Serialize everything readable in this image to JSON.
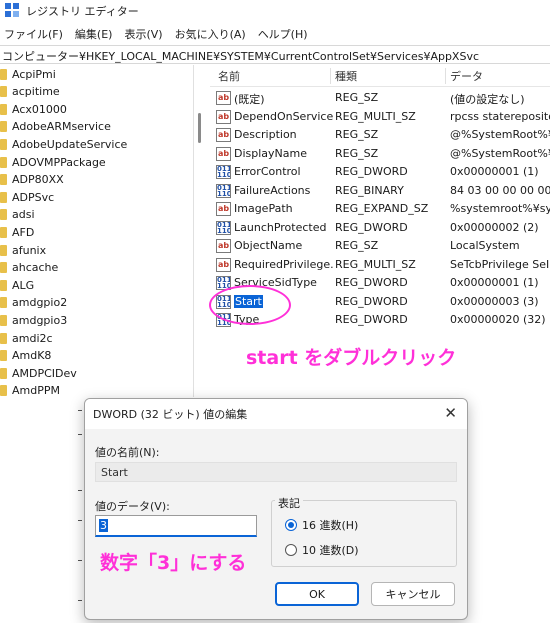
{
  "window": {
    "title": "レジストリ エディター"
  },
  "menu": [
    "ファイル(F)",
    "編集(E)",
    "表示(V)",
    "お気に入り(A)",
    "ヘルプ(H)"
  ],
  "address_path": "コンピューター¥HKEY_LOCAL_MACHINE¥SYSTEM¥CurrentControlSet¥Services¥AppXSvc",
  "tree": [
    "AcpiPmi",
    "acpitime",
    "Acx01000",
    "AdobeARMservice",
    "AdobeUpdateService",
    "ADOVMPPackage",
    "ADP80XX",
    "ADPSvc",
    "adsi",
    "AFD",
    "afunix",
    "ahcache",
    "ALG",
    "amdgpio2",
    "amdgpio3",
    "amdi2c",
    "AmdK8",
    "AMDPCIDev",
    "AmdPPM"
  ],
  "columns": {
    "name": "名前",
    "type": "種類",
    "data": "データ"
  },
  "values": [
    {
      "icon": "string-value-icon",
      "name": "(既定)",
      "type": "REG_SZ",
      "data": "(値の設定なし)"
    },
    {
      "icon": "string-value-icon",
      "name": "DependOnService",
      "type": "REG_MULTI_SZ",
      "data": "rpcss staterepositor"
    },
    {
      "icon": "string-value-icon",
      "name": "Description",
      "type": "REG_SZ",
      "data": "@%SystemRoot%¥sy"
    },
    {
      "icon": "string-value-icon",
      "name": "DisplayName",
      "type": "REG_SZ",
      "data": "@%SystemRoot%¥sy"
    },
    {
      "icon": "binary-value-icon",
      "name": "ErrorControl",
      "type": "REG_DWORD",
      "data": "0x00000001 (1)"
    },
    {
      "icon": "binary-value-icon",
      "name": "FailureActions",
      "type": "REG_BINARY",
      "data": "84 03 00 00 00 00 00"
    },
    {
      "icon": "string-value-icon",
      "name": "ImagePath",
      "type": "REG_EXPAND_SZ",
      "data": "%systemroot%¥syst"
    },
    {
      "icon": "binary-value-icon",
      "name": "LaunchProtected",
      "type": "REG_DWORD",
      "data": "0x00000002 (2)"
    },
    {
      "icon": "string-value-icon",
      "name": "ObjectName",
      "type": "REG_SZ",
      "data": "LocalSystem"
    },
    {
      "icon": "string-value-icon",
      "name": "RequiredPrivilege...",
      "type": "REG_MULTI_SZ",
      "data": "SeTcbPrivilege SeIn"
    },
    {
      "icon": "binary-value-icon",
      "name": "ServiceSidType",
      "type": "REG_DWORD",
      "data": "0x00000001 (1)"
    },
    {
      "icon": "binary-value-icon",
      "name": "Start",
      "type": "REG_DWORD",
      "data": "0x00000003 (3)",
      "selected": true
    },
    {
      "icon": "binary-value-icon",
      "name": "Type",
      "type": "REG_DWORD",
      "data": "0x00000020 (32)"
    }
  ],
  "annotations": {
    "double_click": "start をダブルクリック",
    "set_value": "数字「3」にする"
  },
  "dialog": {
    "title": "DWORD (32 ビット) 値の編集",
    "close": "✕",
    "name_label": "値の名前(N):",
    "name_value": "Start",
    "data_label": "値のデータ(V):",
    "data_value": "3",
    "base_label": "表記",
    "hex_option": "16 進数(H)",
    "dec_option": "10 進数(D)",
    "ok": "OK",
    "cancel": "キャンセル"
  },
  "colors": {
    "accent": "#0a64d6",
    "annotation": "#ff30d8",
    "folder": "#e8c04a"
  }
}
